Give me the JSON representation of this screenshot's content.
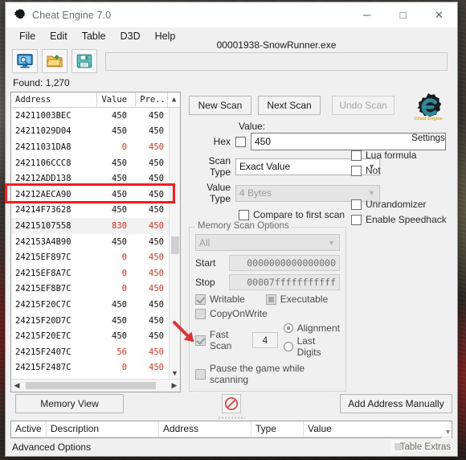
{
  "window": {
    "title": "Cheat Engine 7.0",
    "controls": {
      "minimize": "─",
      "maximize": "□",
      "close": "✕"
    }
  },
  "menu": {
    "items": [
      "File",
      "Edit",
      "Table",
      "D3D",
      "Help"
    ]
  },
  "toolbar": {
    "icons": [
      "open-process-icon",
      "open-file-icon",
      "save-file-icon"
    ],
    "process_title": "00001938-SnowRunner.exe"
  },
  "found": {
    "label": "Found: 1,270"
  },
  "results": {
    "columns": [
      "Address",
      "Value",
      "Pre.."
    ],
    "rows": [
      {
        "address": "24211003BEC",
        "value": "450",
        "previous": "450",
        "value_red": false,
        "prev_red": false
      },
      {
        "address": "24211029D04",
        "value": "450",
        "previous": "450",
        "value_red": false,
        "prev_red": false
      },
      {
        "address": "24211031DA8",
        "value": "0",
        "previous": "450",
        "value_red": true,
        "prev_red": true
      },
      {
        "address": "2421106CCC8",
        "value": "450",
        "previous": "450",
        "value_red": false,
        "prev_red": false
      },
      {
        "address": "24212ADD138",
        "value": "450",
        "previous": "450",
        "value_red": false,
        "prev_red": false
      },
      {
        "address": "24212AECA90",
        "value": "450",
        "previous": "450",
        "value_red": false,
        "prev_red": false
      },
      {
        "address": "24214F73628",
        "value": "450",
        "previous": "450",
        "value_red": false,
        "prev_red": false
      },
      {
        "address": "24215107558",
        "value": "830",
        "previous": "450",
        "value_red": true,
        "prev_red": true,
        "selected": true
      },
      {
        "address": "242153A4B90",
        "value": "450",
        "previous": "450",
        "value_red": false,
        "prev_red": false
      },
      {
        "address": "24215EF897C",
        "value": "0",
        "previous": "450",
        "value_red": true,
        "prev_red": true
      },
      {
        "address": "24215EF8A7C",
        "value": "0",
        "previous": "450",
        "value_red": true,
        "prev_red": true
      },
      {
        "address": "24215EF8B7C",
        "value": "0",
        "previous": "450",
        "value_red": true,
        "prev_red": true
      },
      {
        "address": "24215F20C7C",
        "value": "450",
        "previous": "450",
        "value_red": false,
        "prev_red": false
      },
      {
        "address": "24215F20D7C",
        "value": "450",
        "previous": "450",
        "value_red": false,
        "prev_red": false
      },
      {
        "address": "24215F20E7C",
        "value": "450",
        "previous": "450",
        "value_red": false,
        "prev_red": false
      },
      {
        "address": "24215F2407C",
        "value": "56",
        "previous": "450",
        "value_red": true,
        "prev_red": true
      },
      {
        "address": "24215F2487C",
        "value": "0",
        "previous": "450",
        "value_red": true,
        "prev_red": true
      }
    ]
  },
  "scan": {
    "new_scan": "New Scan",
    "next_scan": "Next Scan",
    "undo_scan": "Undo Scan",
    "settings_label": "Settings",
    "value_label": "Value:",
    "hex_label": "Hex",
    "hex_checked": false,
    "value_input": "450",
    "scan_type_label": "Scan Type",
    "scan_type_value": "Exact Value",
    "value_type_label": "Value Type",
    "value_type_value": "4 Bytes",
    "compare_first_scan": "Compare to first scan",
    "compare_first_scan_checked": false
  },
  "memory_scan_options": {
    "title": "Memory Scan Options",
    "region": "All",
    "start_label": "Start",
    "start_value": "0000000000000000",
    "stop_label": "Stop",
    "stop_value": "00007fffffffffff",
    "writable": {
      "label": "Writable",
      "checked": true
    },
    "executable": {
      "label": "Executable",
      "checked": false
    },
    "copy_on_write": {
      "label": "CopyOnWrite",
      "checked": false
    },
    "fast_scan": {
      "label": "Fast Scan",
      "checked": true
    },
    "fast_scan_value": "4",
    "alignment": {
      "label": "Alignment",
      "selected": true
    },
    "last_digits": {
      "label": "Last Digits",
      "selected": false
    },
    "pause_game": {
      "label": "Pause the game while scanning",
      "checked": false
    }
  },
  "side_options": [
    {
      "label": "Lua formula",
      "checked": false
    },
    {
      "label": "Not",
      "checked": false
    },
    {
      "label": "Unrandomizer",
      "checked": false
    },
    {
      "label": "Enable Speedhack",
      "checked": false
    }
  ],
  "actions": {
    "memory_view": "Memory View",
    "stop_icon": "stop-prohibited-icon",
    "add_address": "Add Address Manually"
  },
  "cheat_table": {
    "columns": [
      "Active",
      "Description",
      "Address",
      "Type",
      "Value"
    ],
    "rows": []
  },
  "status": {
    "advanced_options": "Advanced Options",
    "table_extras": "Table Extras"
  },
  "annotations": {
    "highlight_box": "red-highlight-rectangle",
    "arrow": "red-arrow-pointer"
  },
  "colors": {
    "accent_red": "#ff1a1a",
    "changed_value": "#e8321e",
    "window_bg": "#f0f0f0",
    "ce_teal": "#2b8a96"
  }
}
